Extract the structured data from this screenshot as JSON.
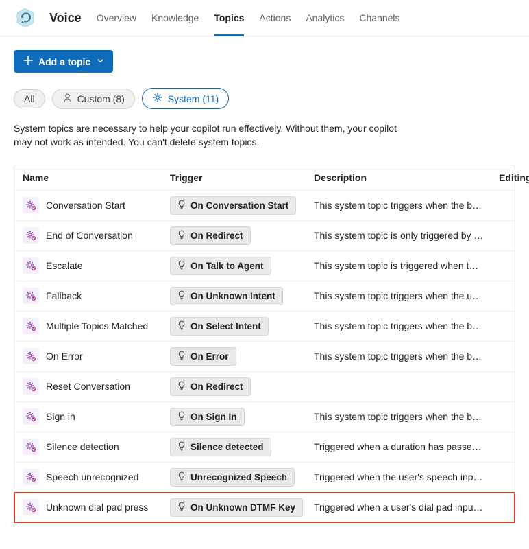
{
  "header": {
    "app_title": "Voice",
    "tabs": [
      {
        "label": "Overview"
      },
      {
        "label": "Knowledge"
      },
      {
        "label": "Topics",
        "active": true
      },
      {
        "label": "Actions"
      },
      {
        "label": "Analytics"
      },
      {
        "label": "Channels"
      }
    ]
  },
  "toolbar": {
    "add_topic_label": "Add a topic"
  },
  "filters": {
    "all_label": "All",
    "custom_label": "Custom (8)",
    "system_label": "System (11)"
  },
  "helper_text": "System topics are necessary to help your copilot run effectively. Without them, your copilot may not work as intended. You can't delete system topics.",
  "columns": {
    "name": "Name",
    "trigger": "Trigger",
    "description": "Description",
    "editing": "Editing"
  },
  "rows": [
    {
      "name": "Conversation Start",
      "trigger": "On Conversation Start",
      "desc": "This system topic triggers when the b…"
    },
    {
      "name": "End of Conversation",
      "trigger": "On Redirect",
      "desc": "This system topic is only triggered by …"
    },
    {
      "name": "Escalate",
      "trigger": "On Talk to Agent",
      "desc": "This system topic is triggered when t…"
    },
    {
      "name": "Fallback",
      "trigger": "On Unknown Intent",
      "desc": "This system topic triggers when the u…"
    },
    {
      "name": "Multiple Topics Matched",
      "trigger": "On Select Intent",
      "desc": "This system topic triggers when the b…"
    },
    {
      "name": "On Error",
      "trigger": "On Error",
      "desc": "This system topic triggers when the b…"
    },
    {
      "name": "Reset Conversation",
      "trigger": "On Redirect",
      "desc": ""
    },
    {
      "name": "Sign in",
      "trigger": "On Sign In",
      "desc": "This system topic triggers when the b…"
    },
    {
      "name": "Silence detection",
      "trigger": "Silence detected",
      "desc": "Triggered when a duration has passe…"
    },
    {
      "name": "Speech unrecognized",
      "trigger": "Unrecognized Speech",
      "desc": "Triggered when the user's speech inp…"
    },
    {
      "name": "Unknown dial pad press",
      "trigger": "On Unknown DTMF Key",
      "desc": "Triggered when a user's dial pad inpu…",
      "highlight": true
    }
  ]
}
